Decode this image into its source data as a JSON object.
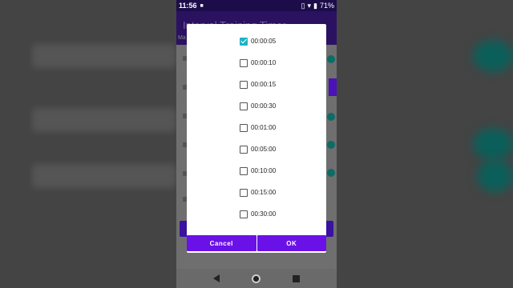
{
  "status_bar": {
    "time": "11:56",
    "battery": "71%"
  },
  "app_bar": {
    "title": "Interval Training Timer",
    "subtitle": "Ma"
  },
  "dialog": {
    "options": [
      {
        "label": "00:00:05",
        "checked": true
      },
      {
        "label": "00:00:10",
        "checked": false
      },
      {
        "label": "00:00:15",
        "checked": false
      },
      {
        "label": "00:00:30",
        "checked": false
      },
      {
        "label": "00:01:00",
        "checked": false
      },
      {
        "label": "00:05:00",
        "checked": false
      },
      {
        "label": "00:10:00",
        "checked": false
      },
      {
        "label": "00:15:00",
        "checked": false
      },
      {
        "label": "00:30:00",
        "checked": false
      }
    ],
    "cancel_label": "Cancel",
    "ok_label": "OK"
  },
  "colors": {
    "accent": "#6a11e8",
    "checkbox_checked": "#1fb3c4",
    "app_bar": "#2a1260",
    "toggle": "#0d6c66"
  }
}
